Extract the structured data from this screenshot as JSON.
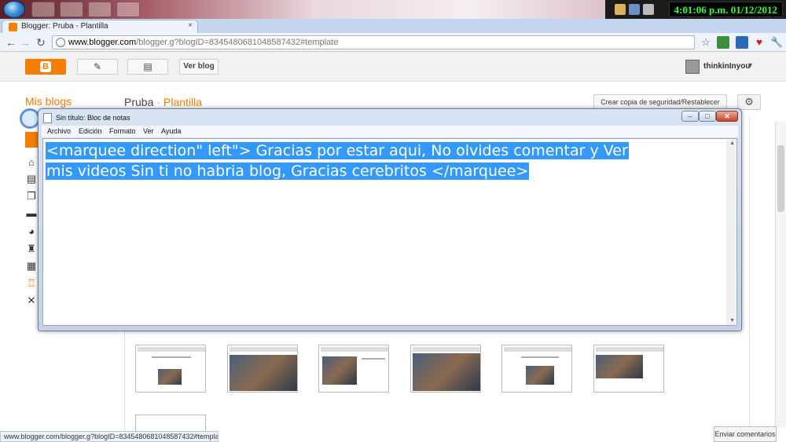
{
  "taskbar": {
    "clock": "4:01:06 p.m. 01/12/2012"
  },
  "browser": {
    "tab_title": "Blogger: Pruba - Plantilla",
    "tab_close": "×",
    "url_host": "www.blogger.com",
    "url_path": "/blogger.g?blogID=8345480681048587432#template",
    "status_url": "www.blogger.com/blogger.g?blogID=8345480681048587432#template"
  },
  "blogger": {
    "view_blog": "Ver blog",
    "user_name": "thinkinInyou",
    "mis_blogs": "Mis blogs",
    "blog_name": "Pruba",
    "breadcrumb_sep": "·",
    "section": "Plantilla",
    "backup_button": "Crear copia de seguridad/Restablecer",
    "feedback": "Enviar comentarios"
  },
  "notepad": {
    "title": "Sin título: Bloc de notas",
    "menu": [
      "Archivo",
      "Edición",
      "Formato",
      "Ver",
      "Ayuda"
    ],
    "line1": "<marquee direction\" left\"> Gracias por estar aqui, No olvides comentar y Ver",
    "line2": "mis videos Sin ti no habria blog, Gracias cerebritos </marquee>",
    "selection_color": "#3399ff"
  },
  "colors": {
    "blogger_orange": "#f57d00",
    "clock_green": "#3cff3c"
  }
}
